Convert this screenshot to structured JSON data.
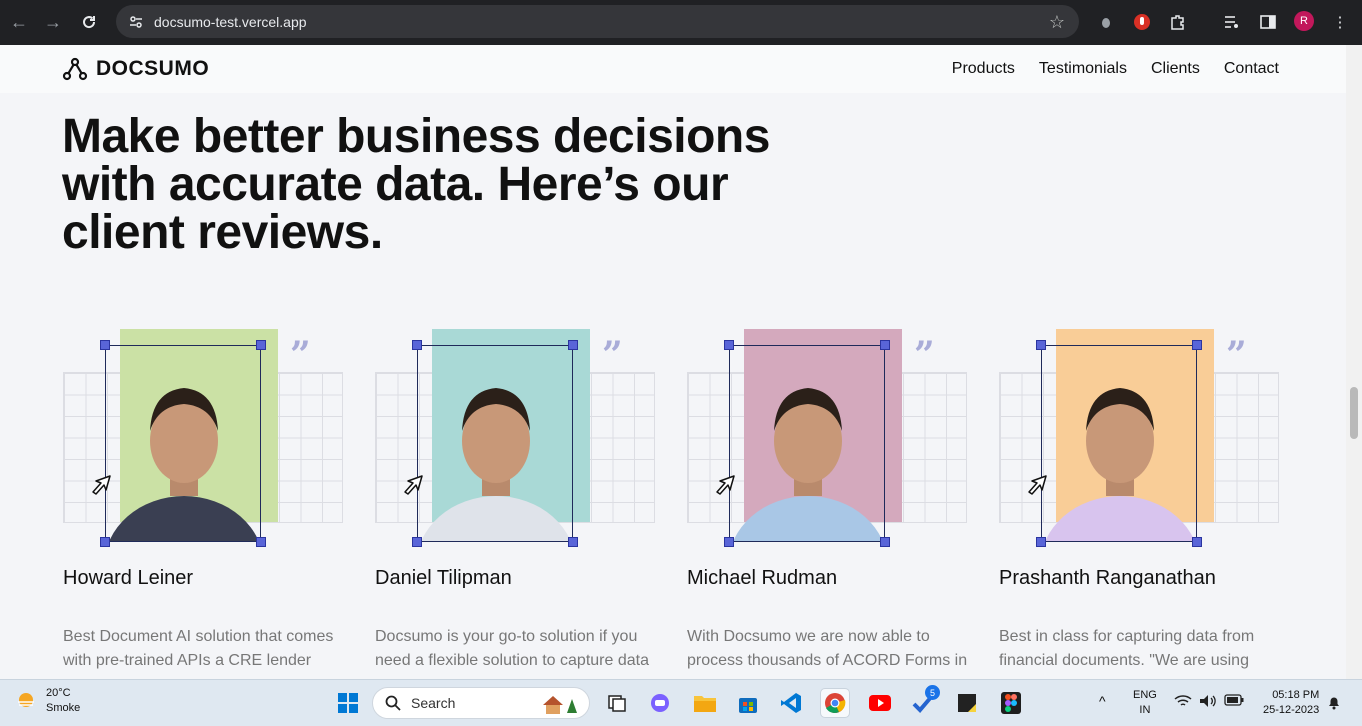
{
  "browser": {
    "url": "docsumo-test.vercel.app",
    "profile_initial": "R"
  },
  "site": {
    "logo_text": "DOCSUMO",
    "nav": [
      "Products",
      "Testimonials",
      "Clients",
      "Contact"
    ]
  },
  "headline": "Make better business decisions with accurate data. Here’s our client reviews.",
  "reviews": [
    {
      "name": "Howard Leiner",
      "text": "Best Document AI solution that comes with pre-trained APIs a CRE lender",
      "bg_color": "#cbe1a5",
      "avatar_color": "#3a3f52"
    },
    {
      "name": "Daniel Tilipman",
      "text": "Docsumo is your go-to solution if you need a flexible solution to capture data",
      "bg_color": "#a9d9d6",
      "avatar_color": "#dfe3ea"
    },
    {
      "name": "Michael Rudman",
      "text": "With Docsumo we are now able to process thousands of ACORD Forms in",
      "bg_color": "#d4a9bd",
      "avatar_color": "#a9c7e6"
    },
    {
      "name": "Prashanth Ranganathan",
      "text": "Best in class for capturing data from financial documents. \"We are using",
      "bg_color": "#f9cd97",
      "avatar_color": "#d8c4ee"
    }
  ],
  "taskbar": {
    "temperature": "20°C",
    "weather": "Smoke",
    "search_placeholder": "Search",
    "language": "ENG",
    "region": "IN",
    "time": "05:18 PM",
    "date": "25-12-2023",
    "todo_badge": "5"
  }
}
